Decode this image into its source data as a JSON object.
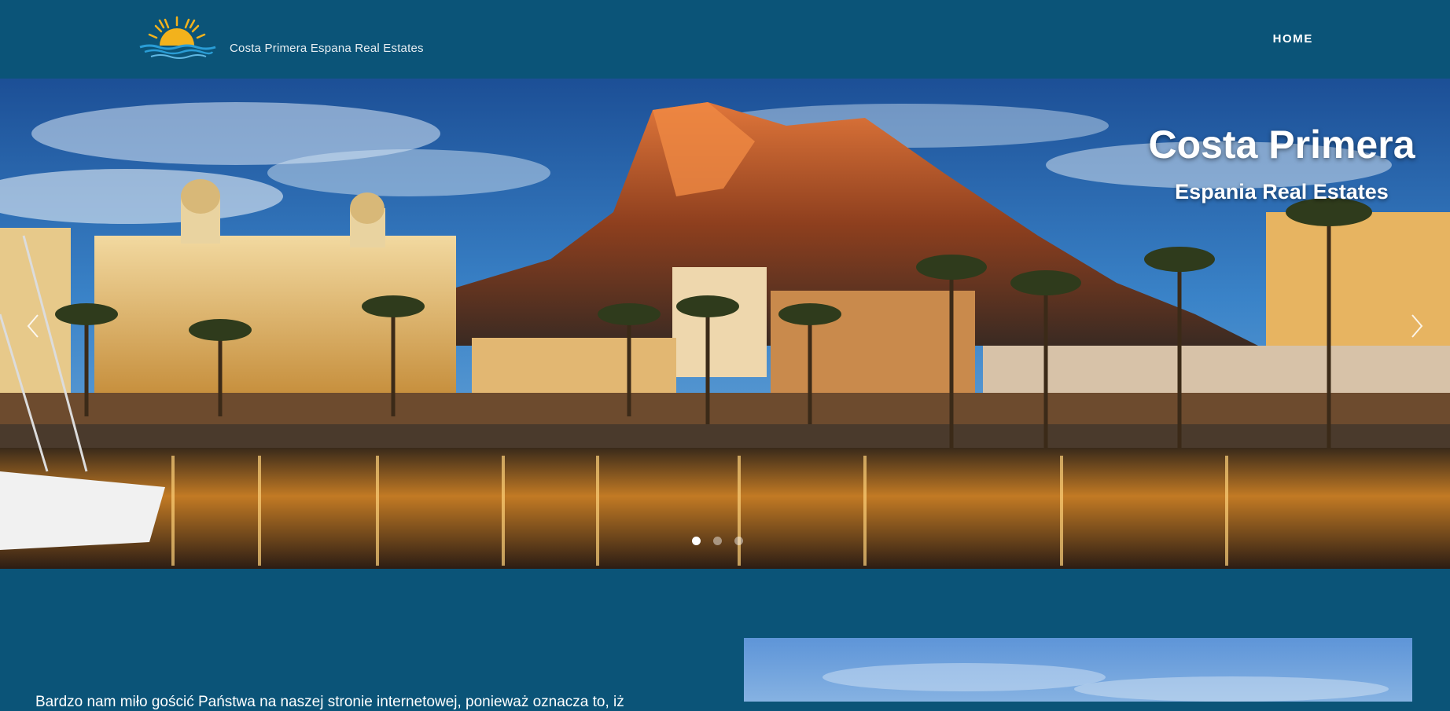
{
  "header": {
    "logo_text": "Costa Primera Espana Real Estates",
    "logo_icon": "sun-over-sea-icon",
    "nav": {
      "home_label": "HOME"
    }
  },
  "hero": {
    "title": "Costa Primera",
    "subtitle": "Espania Real Estates",
    "prev_icon": "chevron-left-icon",
    "next_icon": "chevron-right-icon",
    "slides": [
      {
        "active": true
      },
      {
        "active": false
      },
      {
        "active": false
      }
    ]
  },
  "intro": {
    "text": "Bardzo nam miło gościć Państwa na naszej stronie internetowej, ponieważ oznacza to, iż"
  },
  "colors": {
    "page_background": "#0b5478",
    "accent_sun": "#f3b21c",
    "accent_sea": "#2a9dd6"
  }
}
